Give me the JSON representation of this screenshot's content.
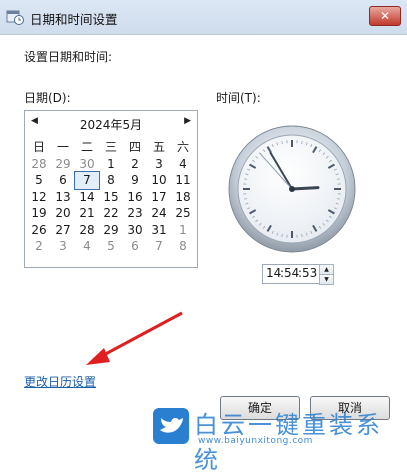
{
  "window": {
    "title": "日期和时间设置",
    "close_label": "✕"
  },
  "heading": "设置日期和时间:",
  "date_label": "日期(D):",
  "time_label": "时间(T):",
  "calendar": {
    "month_label": "2024年5月",
    "weekdays": [
      "日",
      "一",
      "二",
      "三",
      "四",
      "五",
      "六"
    ],
    "weeks": [
      [
        {
          "d": "28",
          "o": true
        },
        {
          "d": "29",
          "o": true
        },
        {
          "d": "30",
          "o": true
        },
        {
          "d": "1"
        },
        {
          "d": "2"
        },
        {
          "d": "3"
        },
        {
          "d": "4"
        }
      ],
      [
        {
          "d": "5"
        },
        {
          "d": "6"
        },
        {
          "d": "7",
          "sel": true
        },
        {
          "d": "8"
        },
        {
          "d": "9"
        },
        {
          "d": "10"
        },
        {
          "d": "11"
        }
      ],
      [
        {
          "d": "12"
        },
        {
          "d": "13"
        },
        {
          "d": "14"
        },
        {
          "d": "15"
        },
        {
          "d": "16"
        },
        {
          "d": "17"
        },
        {
          "d": "18"
        }
      ],
      [
        {
          "d": "19"
        },
        {
          "d": "20"
        },
        {
          "d": "21"
        },
        {
          "d": "22"
        },
        {
          "d": "23"
        },
        {
          "d": "24"
        },
        {
          "d": "25"
        }
      ],
      [
        {
          "d": "26"
        },
        {
          "d": "27"
        },
        {
          "d": "28"
        },
        {
          "d": "29"
        },
        {
          "d": "30"
        },
        {
          "d": "31"
        },
        {
          "d": "1",
          "o": true
        }
      ],
      [
        {
          "d": "2",
          "o": true
        },
        {
          "d": "3",
          "o": true
        },
        {
          "d": "4",
          "o": true
        },
        {
          "d": "5",
          "o": true
        },
        {
          "d": "6",
          "o": true
        },
        {
          "d": "7",
          "o": true
        },
        {
          "d": "8",
          "o": true
        }
      ]
    ]
  },
  "time": {
    "hour": "14",
    "minute": "54",
    "second": "53",
    "separator": ":"
  },
  "change_calendar_link": "更改日历设置",
  "buttons": {
    "ok": "确定",
    "cancel": "取消"
  },
  "watermark": {
    "name": "白云一键重装系统",
    "url": "www.baiyunxitong.com"
  },
  "colors": {
    "link": "#1b5fa8",
    "arrow": "#e02020",
    "watermark": "#2a7fd1"
  }
}
